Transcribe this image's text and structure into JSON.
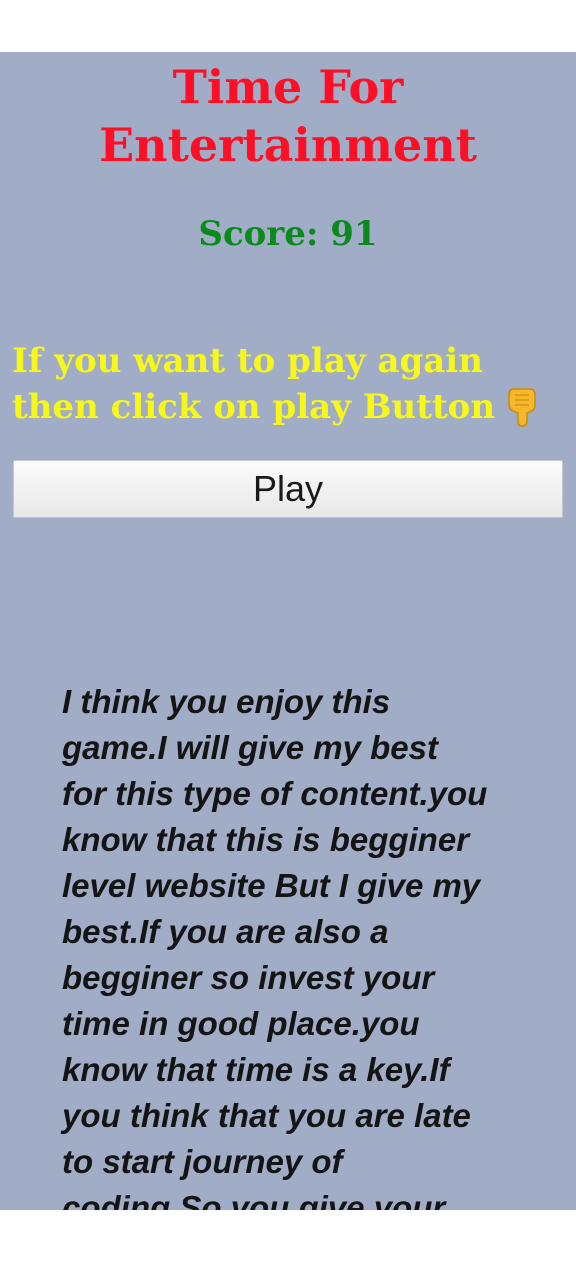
{
  "game": {
    "title_line1": "Time For",
    "title_line2": "Entertainment",
    "score_label": "Score: 91",
    "message_line1": "If you want to play again",
    "message_line2": "then click on play Button",
    "message_icon": "pointing-down-hand-icon",
    "play_label": "Play"
  },
  "essay": {
    "lines": [
      "I think you enjoy this",
      "game.I will give my best",
      "for this type of content.you",
      "know that this is begginer",
      "level website But I give my",
      "best.If you are also a",
      "begginer so invest your",
      "time in good place.you",
      "know that time is a key.If",
      "you think that you are late",
      "to start journey of",
      "coding.So you give your"
    ]
  },
  "colors": {
    "background": "#a1adc6",
    "title": "#ff0f26",
    "score": "#0a8a1c",
    "message": "#f7f71a",
    "essay_text": "#141414"
  }
}
